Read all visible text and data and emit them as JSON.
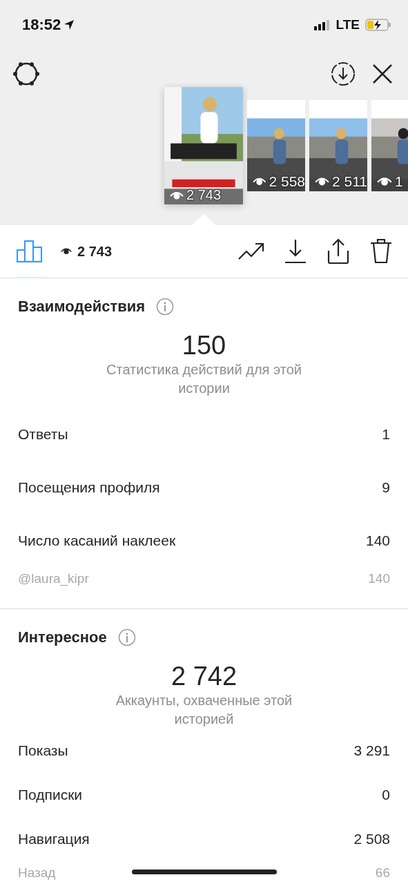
{
  "status_bar": {
    "time": "18:52",
    "network": "LTE"
  },
  "stories": [
    {
      "views": "2 743",
      "selected": true
    },
    {
      "views": "2 558",
      "selected": false
    },
    {
      "views": "2 511",
      "selected": false
    },
    {
      "views": "1",
      "selected": false
    }
  ],
  "toolbar": {
    "views": "2 743"
  },
  "sections": [
    {
      "title": "Взаимодействия",
      "total": "150",
      "caption": "Статистика действий для этой истории",
      "rows": [
        {
          "kind": "main",
          "label": "Ответы",
          "value": "1"
        },
        {
          "kind": "main",
          "label": "Посещения профиля",
          "value": "9"
        },
        {
          "kind": "main",
          "label": "Число касаний наклеек",
          "value": "140"
        },
        {
          "kind": "sub",
          "label": "@laura_kipr",
          "value": "140"
        }
      ]
    },
    {
      "title": "Интересное",
      "total": "2 742",
      "caption": "Аккаунты, охваченные этой историей",
      "rows": [
        {
          "kind": "main",
          "label": "Показы",
          "value": "3 291"
        },
        {
          "kind": "main",
          "label": "Подписки",
          "value": "0"
        },
        {
          "kind": "main",
          "label": "Навигация",
          "value": "2 508"
        },
        {
          "kind": "sub",
          "label": "Назад",
          "value": "66"
        }
      ]
    }
  ]
}
